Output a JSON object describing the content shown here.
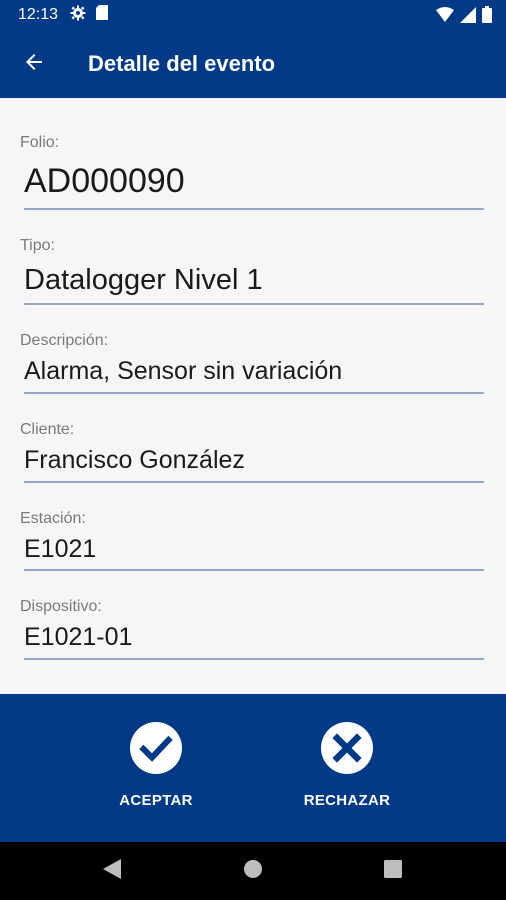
{
  "status_bar": {
    "time": "12:13",
    "left_icons": [
      "gear-icon",
      "sd-card-icon"
    ],
    "right_icons": [
      "wifi-icon",
      "signal-icon",
      "battery-icon"
    ]
  },
  "app_bar": {
    "title": "Detalle del evento",
    "back_icon": "arrow-left-icon"
  },
  "fields": {
    "folio": {
      "label": "Folio:",
      "value": "AD000090"
    },
    "tipo": {
      "label": "Tipo:",
      "value": "Datalogger Nivel 1"
    },
    "descripcion": {
      "label": "Descripción:",
      "value": "Alarma, Sensor sin variación"
    },
    "cliente": {
      "label": "Cliente:",
      "value": "Francisco González"
    },
    "estacion": {
      "label": "Estación:",
      "value": "E1021"
    },
    "dispositivo": {
      "label": "Dispositivo:",
      "value": "E1021-01"
    }
  },
  "actions": {
    "accept": {
      "label": "ACEPTAR",
      "icon": "check-circle-icon"
    },
    "reject": {
      "label": "RECHAZAR",
      "icon": "x-circle-icon"
    }
  },
  "colors": {
    "primary": "#003a86",
    "background": "#f6f6f6",
    "underline": "#9aa3c9",
    "label": "#7a7a7a"
  }
}
